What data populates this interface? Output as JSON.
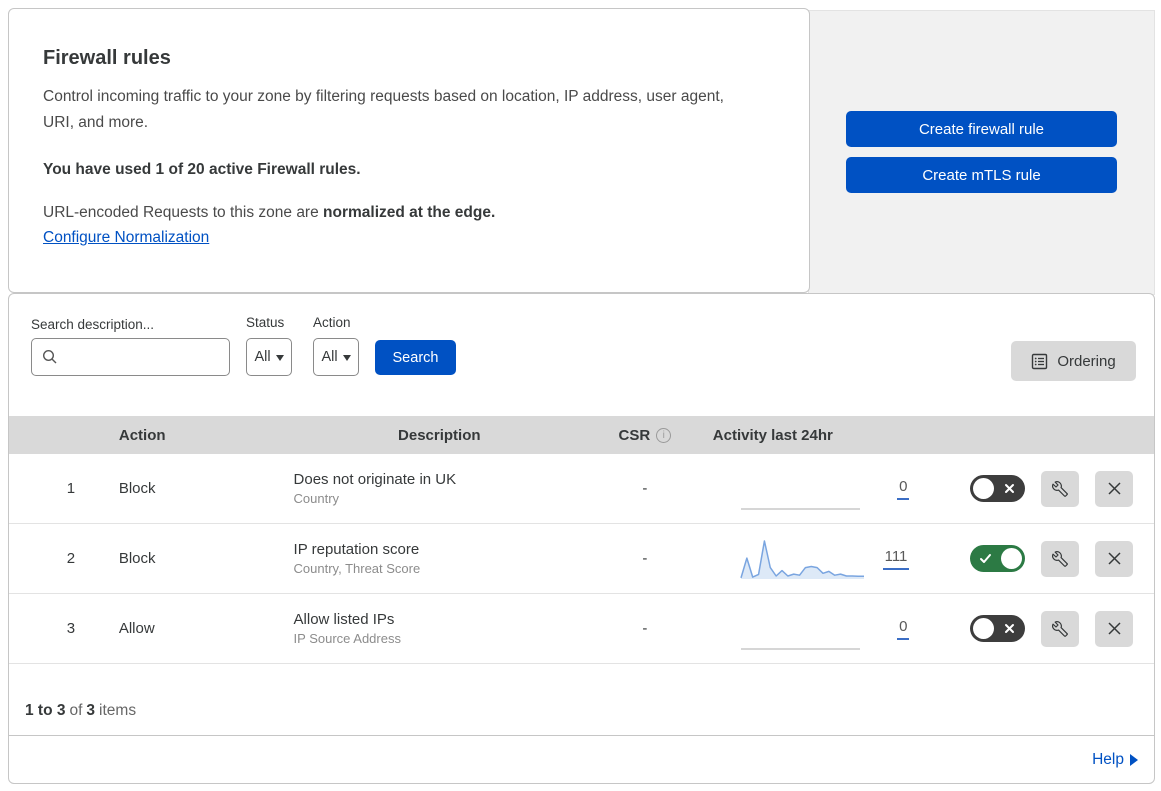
{
  "header": {
    "title": "Firewall rules",
    "description": "Control incoming traffic to your zone by filtering requests based on location, IP address, user agent, URI, and more.",
    "usage": "You have used 1 of 20 active Firewall rules.",
    "normalization_text": "URL-encoded Requests to this zone are",
    "normalization_bold": "normalized at the edge.",
    "normalization_link": "Configure Normalization",
    "buttons": [
      {
        "label": "Create firewall rule"
      },
      {
        "label": "Create mTLS rule"
      }
    ]
  },
  "filters": {
    "search_label": "Search description...",
    "search_value": "",
    "status_label": "Status",
    "status_value": "All",
    "action_label": "Action",
    "action_value": "All",
    "search_button_label": "Search",
    "ordering_button_label": "Ordering"
  },
  "table": {
    "columns": {
      "action": "Action",
      "description": "Description",
      "csr": "CSR",
      "activity": "Activity last 24hr"
    },
    "rows": [
      {
        "priority": "1",
        "action": "Block",
        "description": "Does not originate in UK",
        "match_fields": "Country",
        "csr": "-",
        "activity_count": "0",
        "enabled": false,
        "sparkline": [
          0,
          0,
          0,
          0,
          0,
          0,
          0,
          0,
          0,
          0,
          0,
          0,
          0,
          0,
          0,
          0,
          0,
          0,
          0,
          0,
          0,
          0
        ]
      },
      {
        "priority": "2",
        "action": "Block",
        "description": "IP reputation score",
        "match_fields": "Country, Threat Score",
        "csr": "-",
        "activity_count": "111",
        "enabled": true,
        "sparkline": [
          3,
          55,
          5,
          12,
          100,
          30,
          8,
          22,
          8,
          13,
          10,
          30,
          33,
          30,
          15,
          20,
          10,
          13,
          8,
          8,
          7,
          7
        ]
      },
      {
        "priority": "3",
        "action": "Allow",
        "description": "Allow listed IPs",
        "match_fields": "IP Source Address",
        "csr": "-",
        "activity_count": "0",
        "enabled": false,
        "sparkline": [
          0,
          0,
          0,
          0,
          0,
          0,
          0,
          0,
          0,
          0,
          0,
          0,
          0,
          0,
          0,
          0,
          0,
          0,
          0,
          0,
          0,
          0
        ]
      }
    ]
  },
  "footer": {
    "pagination_range": "1 to 3",
    "pagination_of": "of",
    "pagination_total": "3",
    "pagination_items": "items",
    "help_label": "Help"
  },
  "colors": {
    "primary_blue": "#0051c3",
    "toggle_on_green": "#2c7a44",
    "toggle_off_dark": "#3d3d3d",
    "sparkline_line": "#7aa5e0",
    "sparkline_fill": "#dde9f7",
    "flatline_gray": "#c9c9c9",
    "table_header_gray": "#d9d9d9"
  }
}
